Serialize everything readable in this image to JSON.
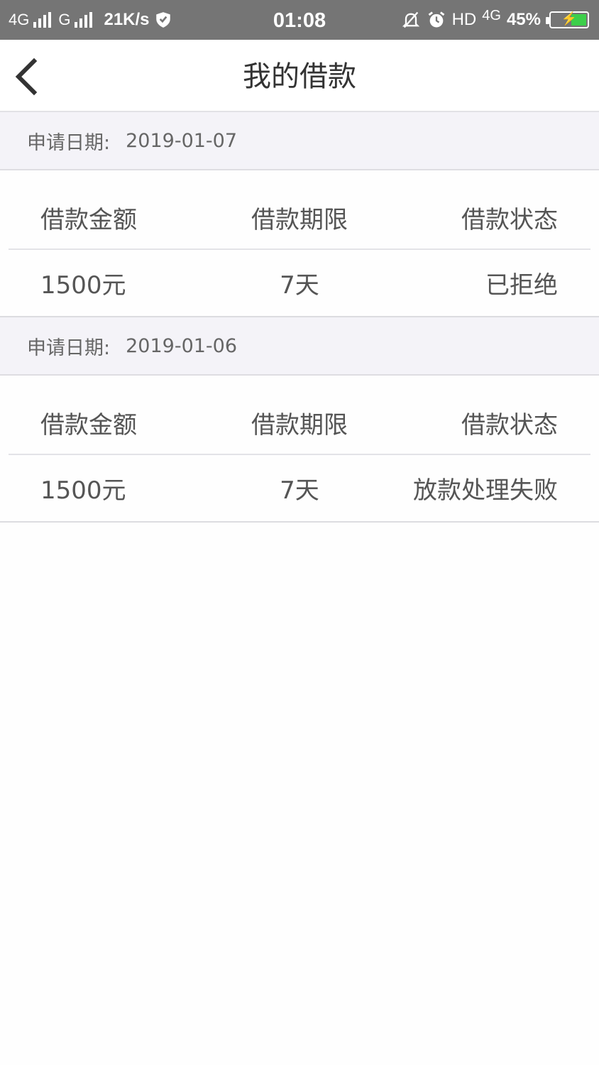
{
  "status_bar": {
    "network1": "4G",
    "network2": "G",
    "speed": "21K/s",
    "time": "01:08",
    "hd": "HD",
    "net_type": "4G",
    "battery_percent": "45%",
    "battery_level": 0.45,
    "battery_color": "#3ccf4a"
  },
  "header": {
    "title": "我的借款"
  },
  "records": [
    {
      "date_label": "申请日期:",
      "date": "2019-01-07",
      "headers": [
        "借款金额",
        "借款期限",
        "借款状态"
      ],
      "amount": "1500元",
      "term": "7天",
      "status": "已拒绝"
    },
    {
      "date_label": "申请日期:",
      "date": "2019-01-06",
      "headers": [
        "借款金额",
        "借款期限",
        "借款状态"
      ],
      "amount": "1500元",
      "term": "7天",
      "status": "放款处理失败"
    }
  ]
}
